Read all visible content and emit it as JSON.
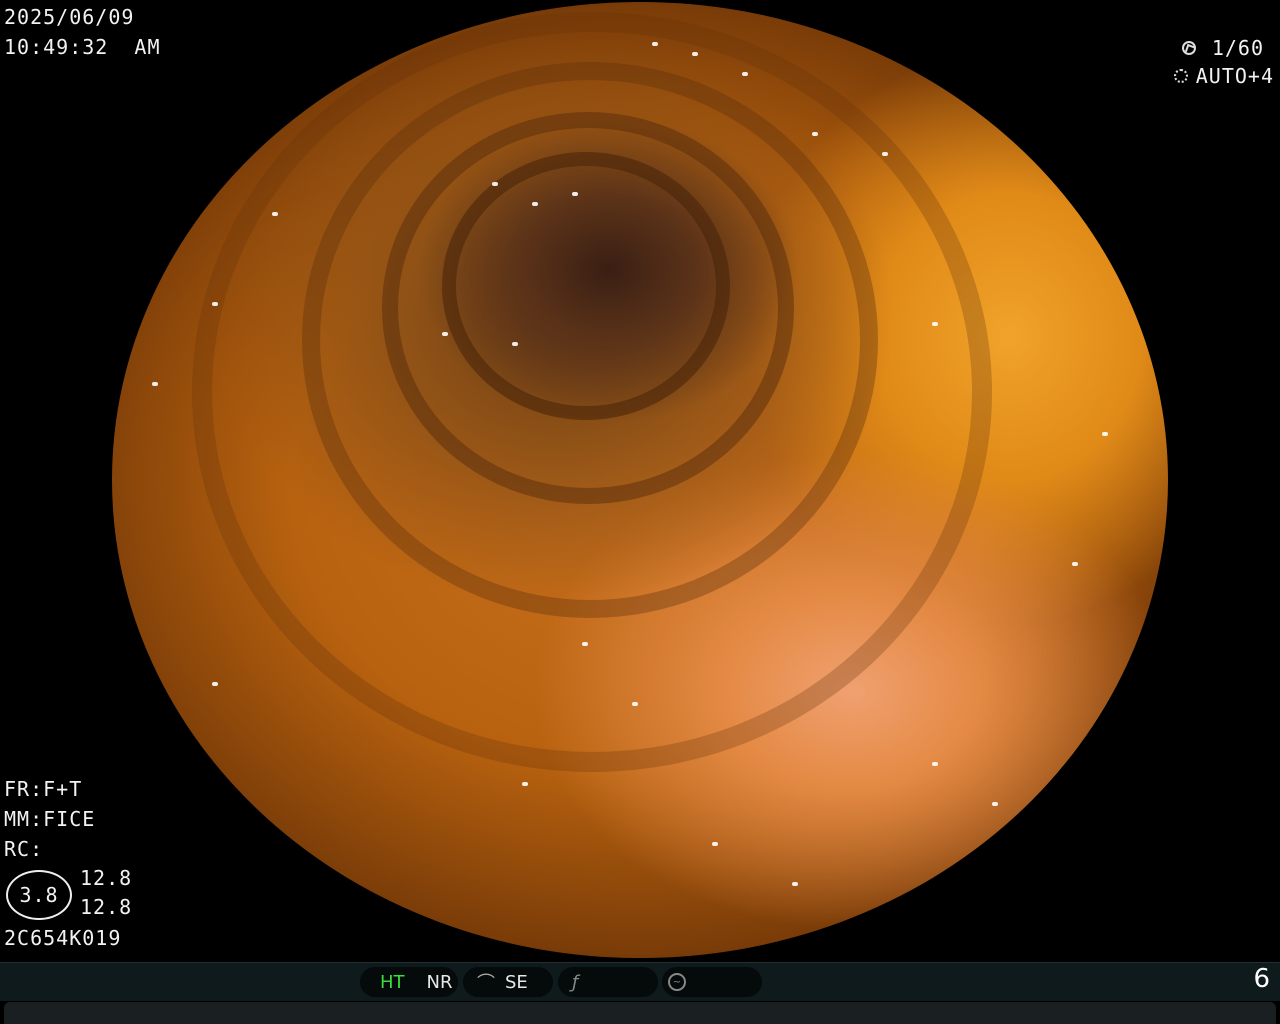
{
  "header": {
    "date": "2025/06/09",
    "time": "10:49:32  AM"
  },
  "camera": {
    "shutter_icon": "aperture-icon",
    "shutter": "1/60",
    "brightness_icon": "brightness-icon",
    "mode": "AUTO+4"
  },
  "settings": {
    "fr": "FR:F+T",
    "mm": "MM:FICE",
    "rc": "RC:",
    "ring_value": "3.8",
    "value1": "12.8",
    "value2": "12.8",
    "serial": "2C654K019"
  },
  "status_bar": {
    "ht": "HT",
    "nr": "NR",
    "se_icon": "structure-enhancement-icon",
    "se": "SE",
    "curve_icon": "curve-icon",
    "circle_icon": "color-mode-icon",
    "page_number": "6"
  },
  "colors": {
    "ht_active": "#3ddc3d",
    "status_bar_bg": "#0f1a1c"
  }
}
